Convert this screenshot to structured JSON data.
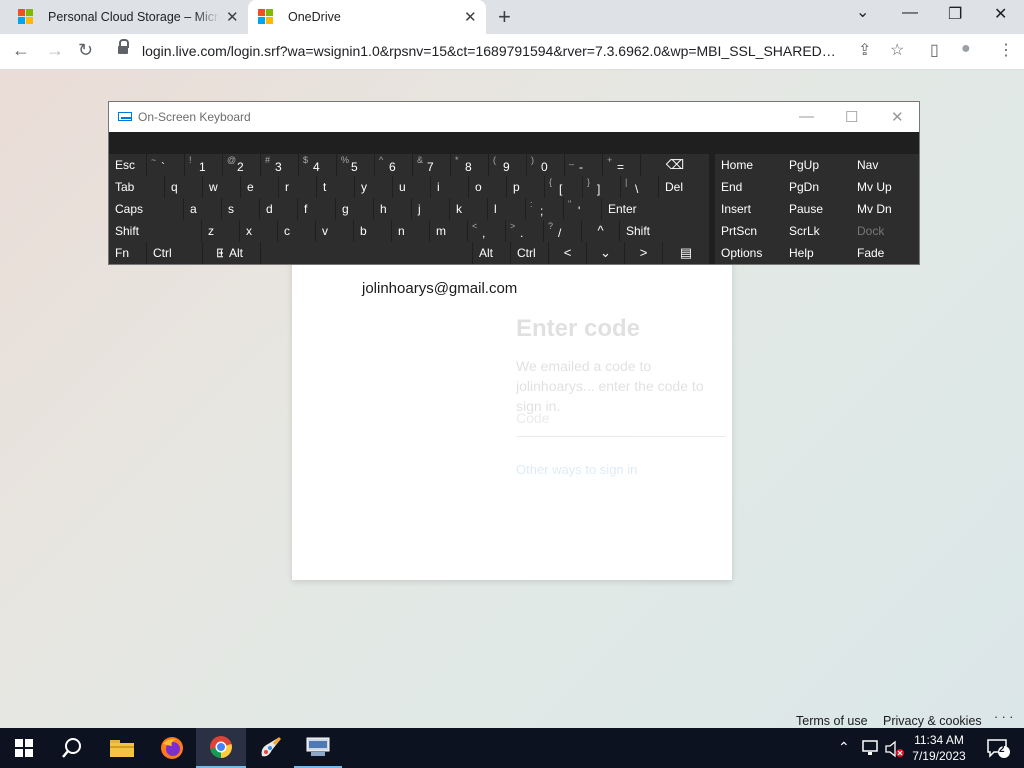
{
  "browser": {
    "tabs": [
      {
        "title": "Personal Cloud Storage – Microsoft"
      },
      {
        "title": "OneDrive"
      }
    ],
    "address_url": "login.live.com/login.srf?wa=wsignin1.0&rpsnv=15&ct=1689791594&rver=7.3.6962.0&wp=MBI_SSL_SHARED&w...",
    "icons": {
      "close": "✕",
      "new_tab": "+",
      "chevron": "⌄",
      "minimize": "—",
      "restore": "❐",
      "window_close": "✕",
      "back": "←",
      "forward": "→",
      "reload": "↻",
      "share": "⇪",
      "star": "☆",
      "sidebar": "▯",
      "profile": "●",
      "menu": "⋮"
    }
  },
  "page": {
    "email": "jolinhoarys@gmail.com",
    "faded_title": "Enter code",
    "faded_description": "We emailed a code to jolinhoarys... enter the code to sign in.",
    "faded_input_placeholder": "Code",
    "faded_link": "Other ways to sign in",
    "footer": {
      "terms": "Terms of use",
      "privacy": "Privacy & cookies",
      "more": "· · ·"
    }
  },
  "osk": {
    "title": "On-Screen Keyboard",
    "controls": {
      "minimize": "—",
      "maximize": "☐",
      "close": "✕"
    },
    "rows": [
      [
        {
          "label": "Esc"
        },
        {
          "sec": "~",
          "pri": "`"
        },
        {
          "sec": "!",
          "pri": "1"
        },
        {
          "sec": "@",
          "pri": "2"
        },
        {
          "sec": "#",
          "pri": "3"
        },
        {
          "sec": "$",
          "pri": "4"
        },
        {
          "sec": "%",
          "pri": "5"
        },
        {
          "sec": "^",
          "pri": "6"
        },
        {
          "sec": "&",
          "pri": "7"
        },
        {
          "sec": "*",
          "pri": "8"
        },
        {
          "sec": "(",
          "pri": "9"
        },
        {
          "sec": ")",
          "pri": "0"
        },
        {
          "sec": "_",
          "pri": "-"
        },
        {
          "sec": "+",
          "pri": "="
        },
        {
          "label": "⌫"
        },
        {
          "label": "Home"
        },
        {
          "label": "PgUp"
        },
        {
          "label": "Nav"
        }
      ],
      [
        {
          "label": "Tab"
        },
        {
          "label": "q"
        },
        {
          "label": "w"
        },
        {
          "label": "e"
        },
        {
          "label": "r"
        },
        {
          "label": "t"
        },
        {
          "label": "y"
        },
        {
          "label": "u"
        },
        {
          "label": "i"
        },
        {
          "label": "o"
        },
        {
          "label": "p"
        },
        {
          "sec": "{",
          "pri": "["
        },
        {
          "sec": "}",
          "pri": "]"
        },
        {
          "sec": "|",
          "pri": "\\"
        },
        {
          "label": "Del"
        },
        {
          "label": "End"
        },
        {
          "label": "PgDn"
        },
        {
          "label": "Mv Up"
        }
      ],
      [
        {
          "label": "Caps"
        },
        {
          "label": "a"
        },
        {
          "label": "s"
        },
        {
          "label": "d"
        },
        {
          "label": "f"
        },
        {
          "label": "g"
        },
        {
          "label": "h"
        },
        {
          "label": "j"
        },
        {
          "label": "k"
        },
        {
          "label": "l"
        },
        {
          "sec": ":",
          "pri": ";"
        },
        {
          "sec": "\"",
          "pri": "'"
        },
        {
          "label": "Enter"
        },
        {
          "label": "Insert"
        },
        {
          "label": "Pause"
        },
        {
          "label": "Mv Dn"
        }
      ],
      [
        {
          "label": "Shift"
        },
        {
          "label": "z"
        },
        {
          "label": "x"
        },
        {
          "label": "c"
        },
        {
          "label": "v"
        },
        {
          "label": "b"
        },
        {
          "label": "n"
        },
        {
          "label": "m"
        },
        {
          "sec": "<",
          "pri": ","
        },
        {
          "sec": ">",
          "pri": "."
        },
        {
          "sec": "?",
          "pri": "/"
        },
        {
          "label": "^"
        },
        {
          "label": "Shift"
        },
        {
          "label": "PrtScn"
        },
        {
          "label": "ScrLk"
        },
        {
          "label": "Dock",
          "dim": true
        }
      ],
      [
        {
          "label": "Fn"
        },
        {
          "label": "Ctrl"
        },
        {
          "label": "⊞"
        },
        {
          "label": "Alt"
        },
        {
          "label": ""
        },
        {
          "label": "Alt"
        },
        {
          "label": "Ctrl"
        },
        {
          "label": "<"
        },
        {
          "label": "⌄"
        },
        {
          "label": ">"
        },
        {
          "label": "▤"
        },
        {
          "label": "Options"
        },
        {
          "label": "Help"
        },
        {
          "label": "Fade"
        }
      ]
    ]
  },
  "taskbar": {
    "time": "11:34 AM",
    "date": "7/19/2023",
    "notification_count": "2",
    "icons": {
      "start": "windows-start",
      "search": "🔍",
      "tray_up": "⌃"
    }
  }
}
